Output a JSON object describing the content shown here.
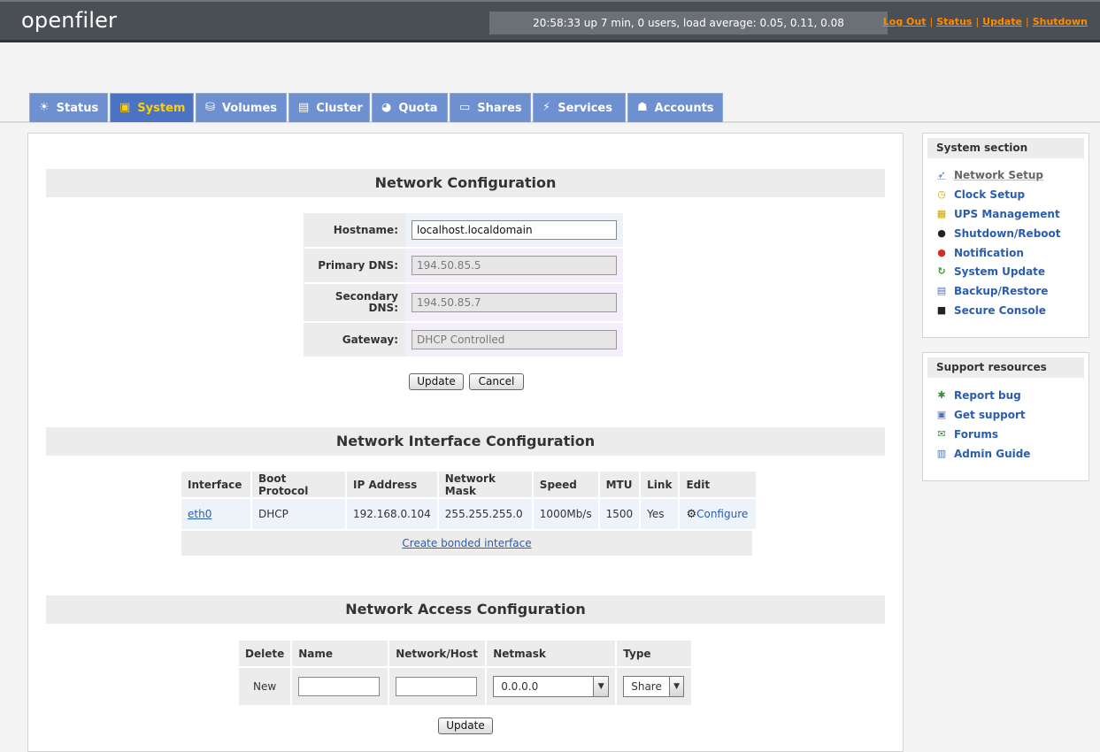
{
  "header": {
    "logo": "openfiler",
    "uptime": "20:58:33 up 7 min, 0 users, load average: 0.05, 0.11, 0.08",
    "links": [
      "Log Out",
      "Status",
      "Update",
      "Shutdown"
    ]
  },
  "tabs": [
    {
      "label": "Status",
      "icon": "status-icon"
    },
    {
      "label": "System",
      "icon": "system-icon",
      "active": true
    },
    {
      "label": "Volumes",
      "icon": "volumes-icon"
    },
    {
      "label": "Cluster",
      "icon": "cluster-icon"
    },
    {
      "label": "Quota",
      "icon": "quota-icon"
    },
    {
      "label": "Shares",
      "icon": "shares-icon"
    },
    {
      "label": "Services",
      "icon": "services-icon"
    },
    {
      "label": "Accounts",
      "icon": "accounts-icon"
    }
  ],
  "network_config": {
    "title": "Network Configuration",
    "hostname_label": "Hostname:",
    "hostname_value": "localhost.localdomain",
    "primary_dns_label": "Primary DNS:",
    "primary_dns_value": "194.50.85.5",
    "secondary_dns_label": "Secondary DNS:",
    "secondary_dns_value": "194.50.85.7",
    "gateway_label": "Gateway:",
    "gateway_value": "DHCP Controlled",
    "update_label": "Update",
    "cancel_label": "Cancel"
  },
  "interface_config": {
    "title": "Network Interface Configuration",
    "headers": [
      "Interface",
      "Boot Protocol",
      "IP Address",
      "Network Mask",
      "Speed",
      "MTU",
      "Link",
      "Edit"
    ],
    "row": {
      "interface": "eth0",
      "boot_protocol": "DHCP",
      "ip": "192.168.0.104",
      "mask": "255.255.255.0",
      "speed": "1000Mb/s",
      "mtu": "1500",
      "link": "Yes",
      "edit": "Configure"
    },
    "bonded_link": "Create bonded interface"
  },
  "access_config": {
    "title": "Network Access Configuration",
    "headers": [
      "Delete",
      "Name",
      "Network/Host",
      "Netmask",
      "Type"
    ],
    "new_label": "New",
    "netmask_value": "0.0.0.0",
    "type_value": "Share",
    "update_label": "Update"
  },
  "sidebar": {
    "system_title": "System section",
    "system_items": [
      {
        "label": "Network Setup",
        "icon": "network-setup-icon",
        "active": true
      },
      {
        "label": "Clock Setup",
        "icon": "clock-icon"
      },
      {
        "label": "UPS Management",
        "icon": "ups-icon"
      },
      {
        "label": "Shutdown/Reboot",
        "icon": "shutdown-icon"
      },
      {
        "label": "Notification",
        "icon": "notification-icon"
      },
      {
        "label": "System Update",
        "icon": "system-update-icon"
      },
      {
        "label": "Backup/Restore",
        "icon": "backup-icon"
      },
      {
        "label": "Secure Console",
        "icon": "console-icon"
      }
    ],
    "support_title": "Support resources",
    "support_items": [
      {
        "label": "Report bug",
        "icon": "bug-icon"
      },
      {
        "label": "Get support",
        "icon": "support-icon"
      },
      {
        "label": "Forums",
        "icon": "forums-icon"
      },
      {
        "label": "Admin Guide",
        "icon": "guide-icon"
      }
    ]
  },
  "colors": {
    "header_bg": "#4a4f55",
    "tab_bg": "#6e8fd0",
    "tab_active_text": "#ffd000",
    "link": "#2a5db0",
    "toplink": "#ff8a00"
  }
}
